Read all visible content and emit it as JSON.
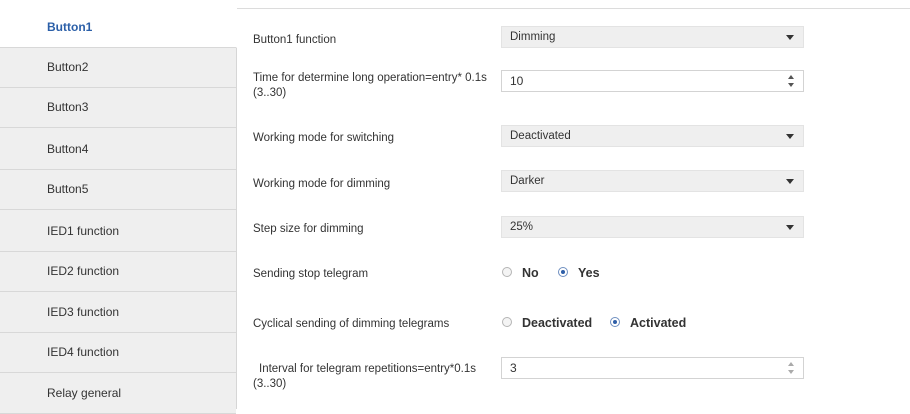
{
  "sidebar": {
    "items": [
      {
        "label": "Button1"
      },
      {
        "label": "Button2"
      },
      {
        "label": "Button3"
      },
      {
        "label": "Button4"
      },
      {
        "label": "Button5"
      },
      {
        "label": "IED1 function"
      },
      {
        "label": "IED2 function"
      },
      {
        "label": "IED3 function"
      },
      {
        "label": "IED4 function"
      },
      {
        "label": "Relay general"
      }
    ]
  },
  "params": {
    "button1_function": {
      "label": "Button1 function",
      "value": "Dimming"
    },
    "long_operation_time": {
      "label": "Time for determine long operation=entry* 0.1s",
      "range": "(3..30)",
      "value": "10"
    },
    "working_mode_switching": {
      "label": "Working mode for switching",
      "value": "Deactivated"
    },
    "working_mode_dimming": {
      "label": "Working mode for dimming",
      "value": "Darker"
    },
    "step_size_dimming": {
      "label": "Step size for dimming",
      "value": "25%"
    },
    "sending_stop_telegram": {
      "label": "Sending stop telegram",
      "option_no": "No",
      "option_yes": "Yes",
      "selected": "Yes"
    },
    "cyclical_sending": {
      "label": "Cyclical sending of dimming telegrams",
      "option_deactivated": "Deactivated",
      "option_activated": "Activated",
      "selected": "Activated"
    },
    "interval_repetitions": {
      "label": "Interval for telegram repetitions=entry*0.1s",
      "range": "(3..30)",
      "value": "3"
    }
  }
}
